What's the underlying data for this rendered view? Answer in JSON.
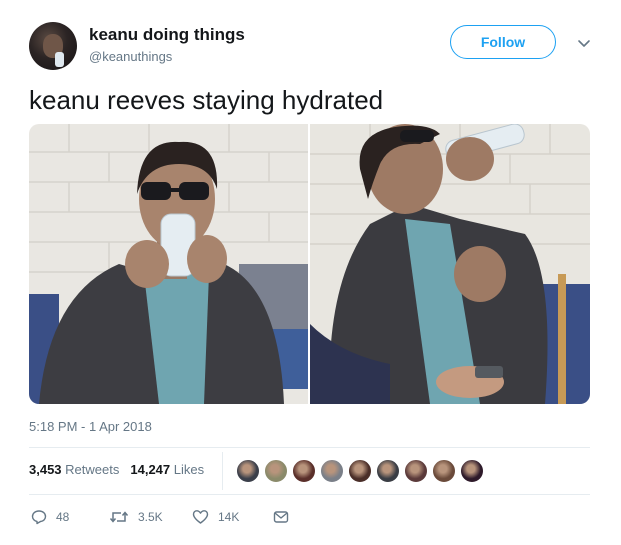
{
  "user": {
    "display_name": "keanu doing things",
    "handle": "@keanuthings"
  },
  "follow_label": "Follow",
  "tweet_text": "keanu reeves staying hydrated",
  "timestamp": "5:18 PM - 1 Apr 2018",
  "stats": {
    "retweets_count": "3,453",
    "retweets_label": "Retweets",
    "likes_count": "14,247",
    "likes_label": "Likes"
  },
  "actions": {
    "replies": "48",
    "retweets": "3.5K",
    "likes": "14K"
  },
  "colors": {
    "accent": "#1da1f2",
    "secondary_text": "#657786",
    "divider": "#e6ecf0"
  },
  "icons": {
    "caret": "chevron-down-icon",
    "reply": "reply-icon",
    "retweet": "retweet-icon",
    "like": "heart-icon",
    "dm": "envelope-icon"
  },
  "liker_avatar_colors": [
    "#3b3f4a",
    "#8a8a6a",
    "#5a2f2a",
    "#7a7f88",
    "#4a2e28",
    "#3a3d44",
    "#5b3a3a",
    "#6a4a3a",
    "#2e1a2a"
  ]
}
